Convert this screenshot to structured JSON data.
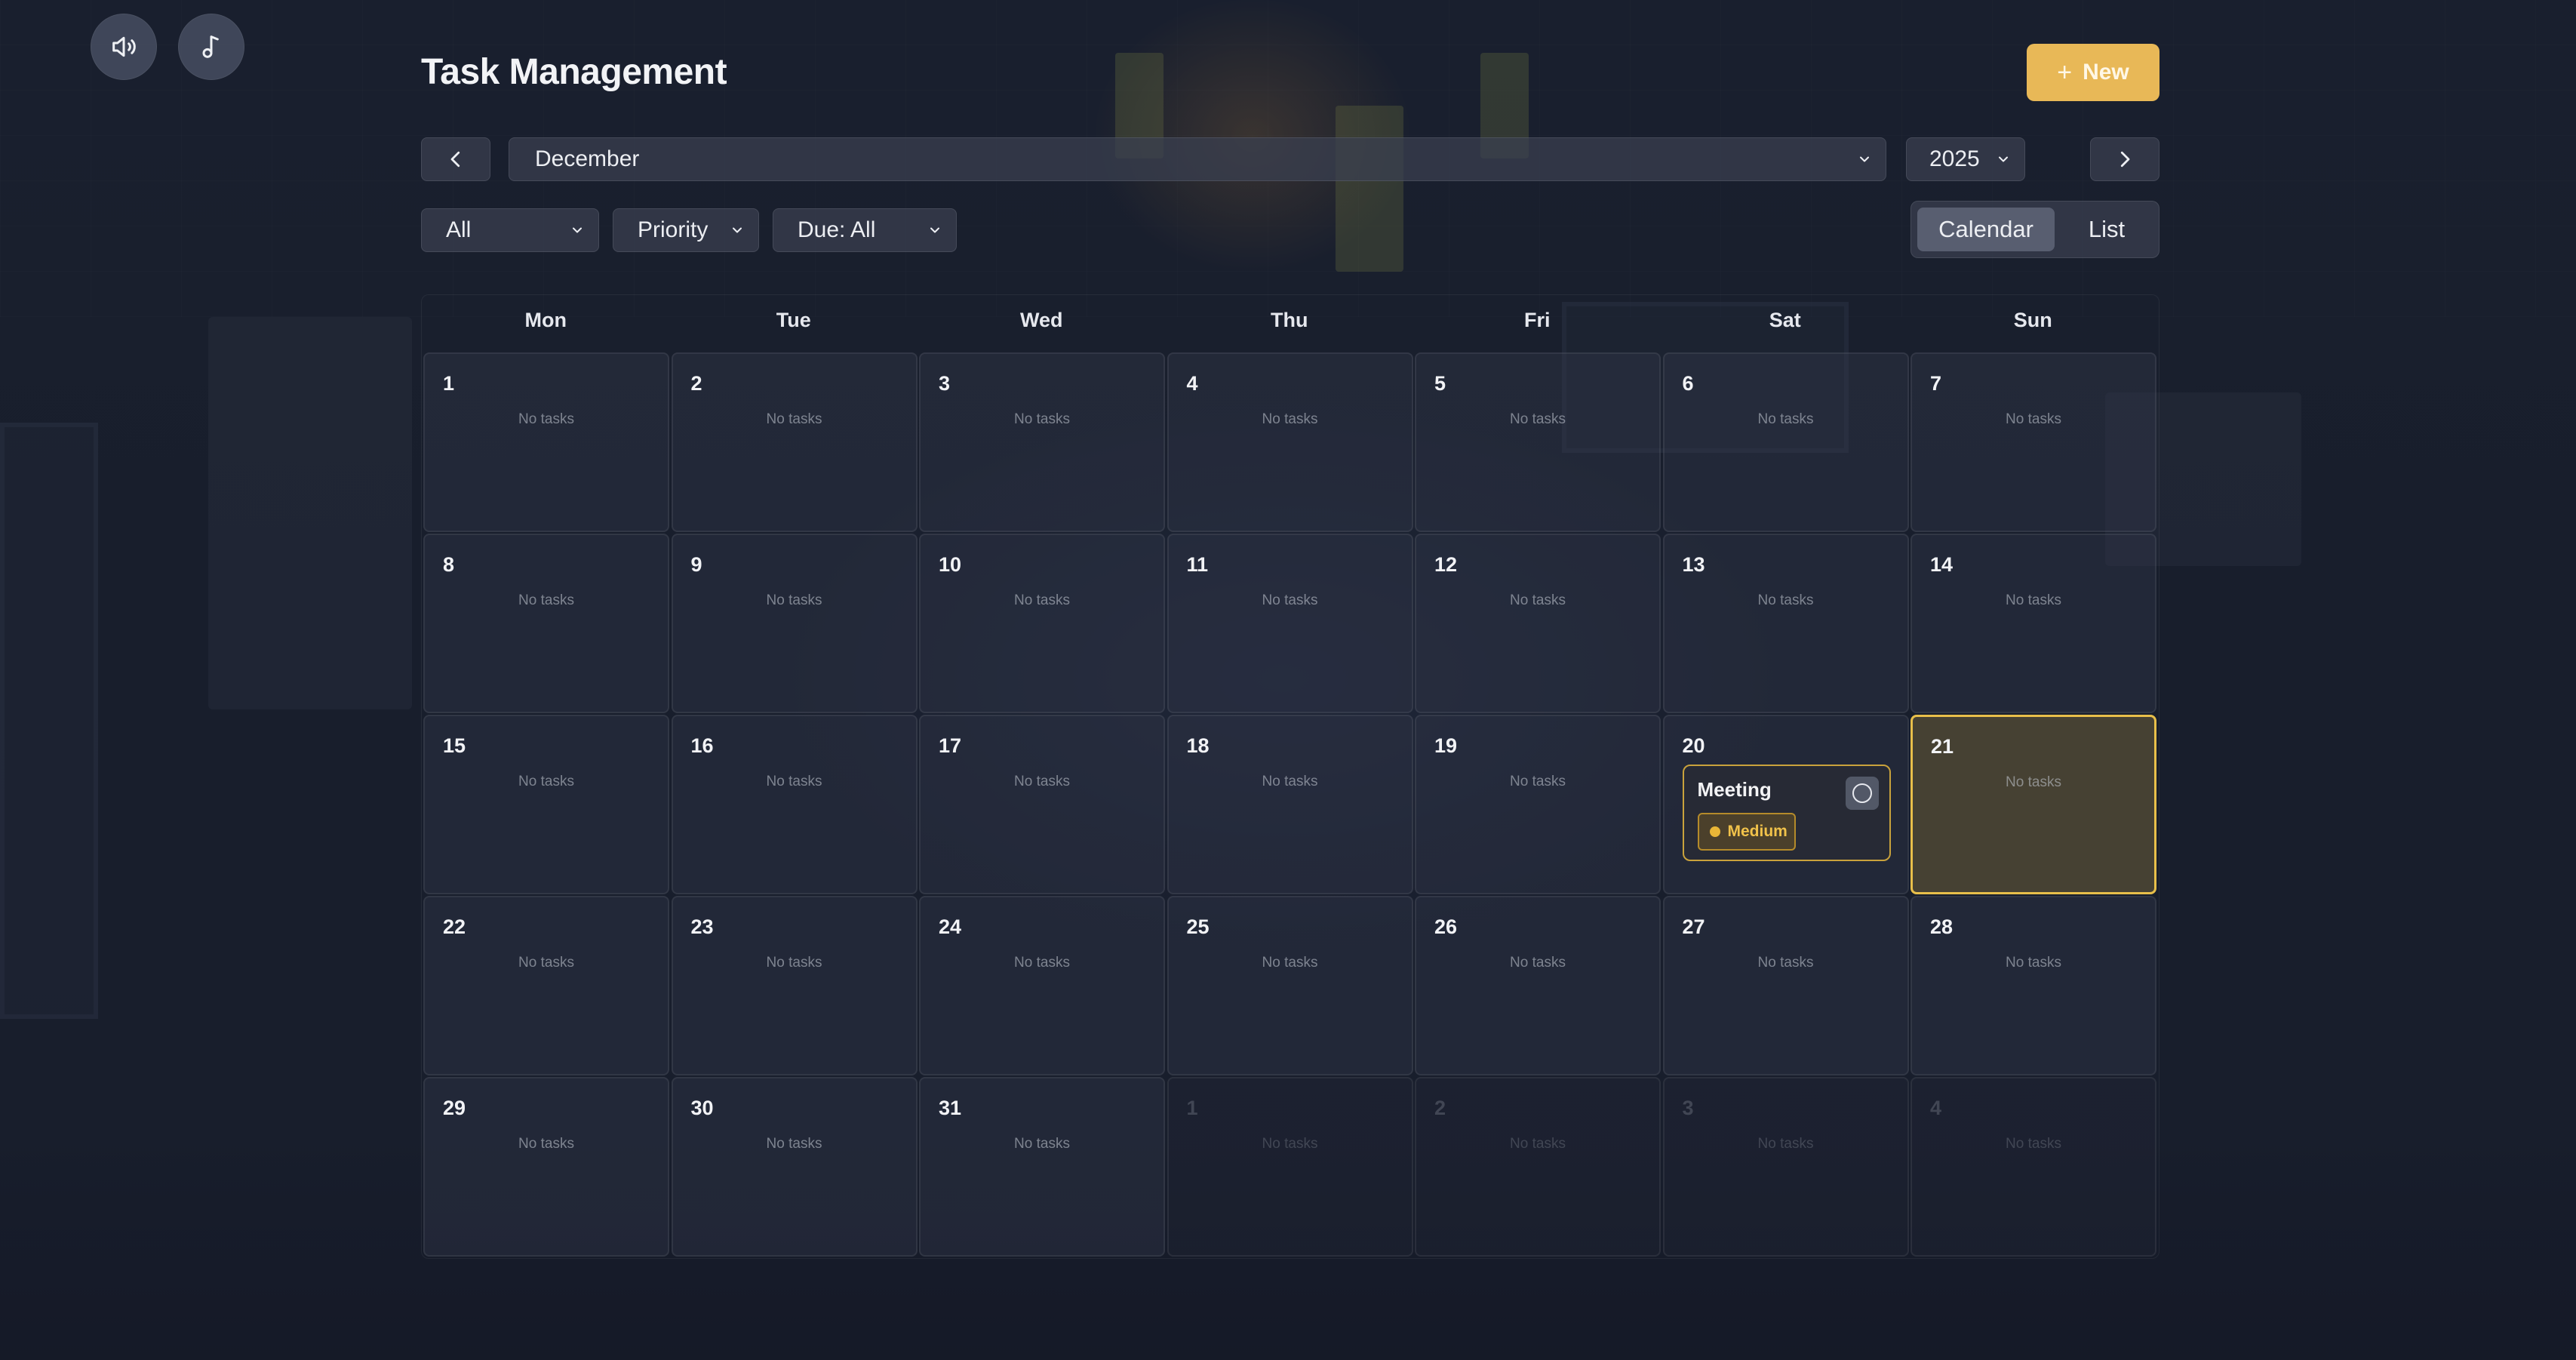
{
  "app": {
    "title": "Task Management",
    "new_button_label": "New",
    "new_button_icon": "plus-icon"
  },
  "top_controls": {
    "sound_icon": "speaker-icon",
    "music_icon": "music-note-icon"
  },
  "navigation": {
    "prev_icon": "chevron-left-icon",
    "next_icon": "chevron-right-icon",
    "month": "December",
    "year": "2025"
  },
  "filters": {
    "status": "All",
    "priority": "Priority",
    "due": "Due: All"
  },
  "view_toggle": {
    "options": [
      "Calendar",
      "List"
    ],
    "active": "Calendar"
  },
  "calendar": {
    "weekdays": [
      "Mon",
      "Tue",
      "Wed",
      "Thu",
      "Fri",
      "Sat",
      "Sun"
    ],
    "empty_label": "No tasks",
    "today": 21,
    "weeks": [
      [
        1,
        2,
        3,
        4,
        5,
        6,
        7
      ],
      [
        8,
        9,
        10,
        11,
        12,
        13,
        14
      ],
      [
        15,
        16,
        17,
        18,
        19,
        20,
        21
      ],
      [
        22,
        23,
        24,
        25,
        26,
        27,
        28
      ],
      [
        29,
        30,
        31,
        1,
        2,
        3,
        4
      ]
    ],
    "outside_month_cells": [
      "week5-day4",
      "week5-day5",
      "week5-day6",
      "week5-day7"
    ],
    "tasks": [
      {
        "day": 20,
        "title": "Meeting",
        "priority": "Medium",
        "priority_color": "#e9b637",
        "done": false
      }
    ]
  },
  "colors": {
    "accent": "#e8b857",
    "today_border": "#e8bf4a",
    "medium_priority": "#e9b637"
  }
}
